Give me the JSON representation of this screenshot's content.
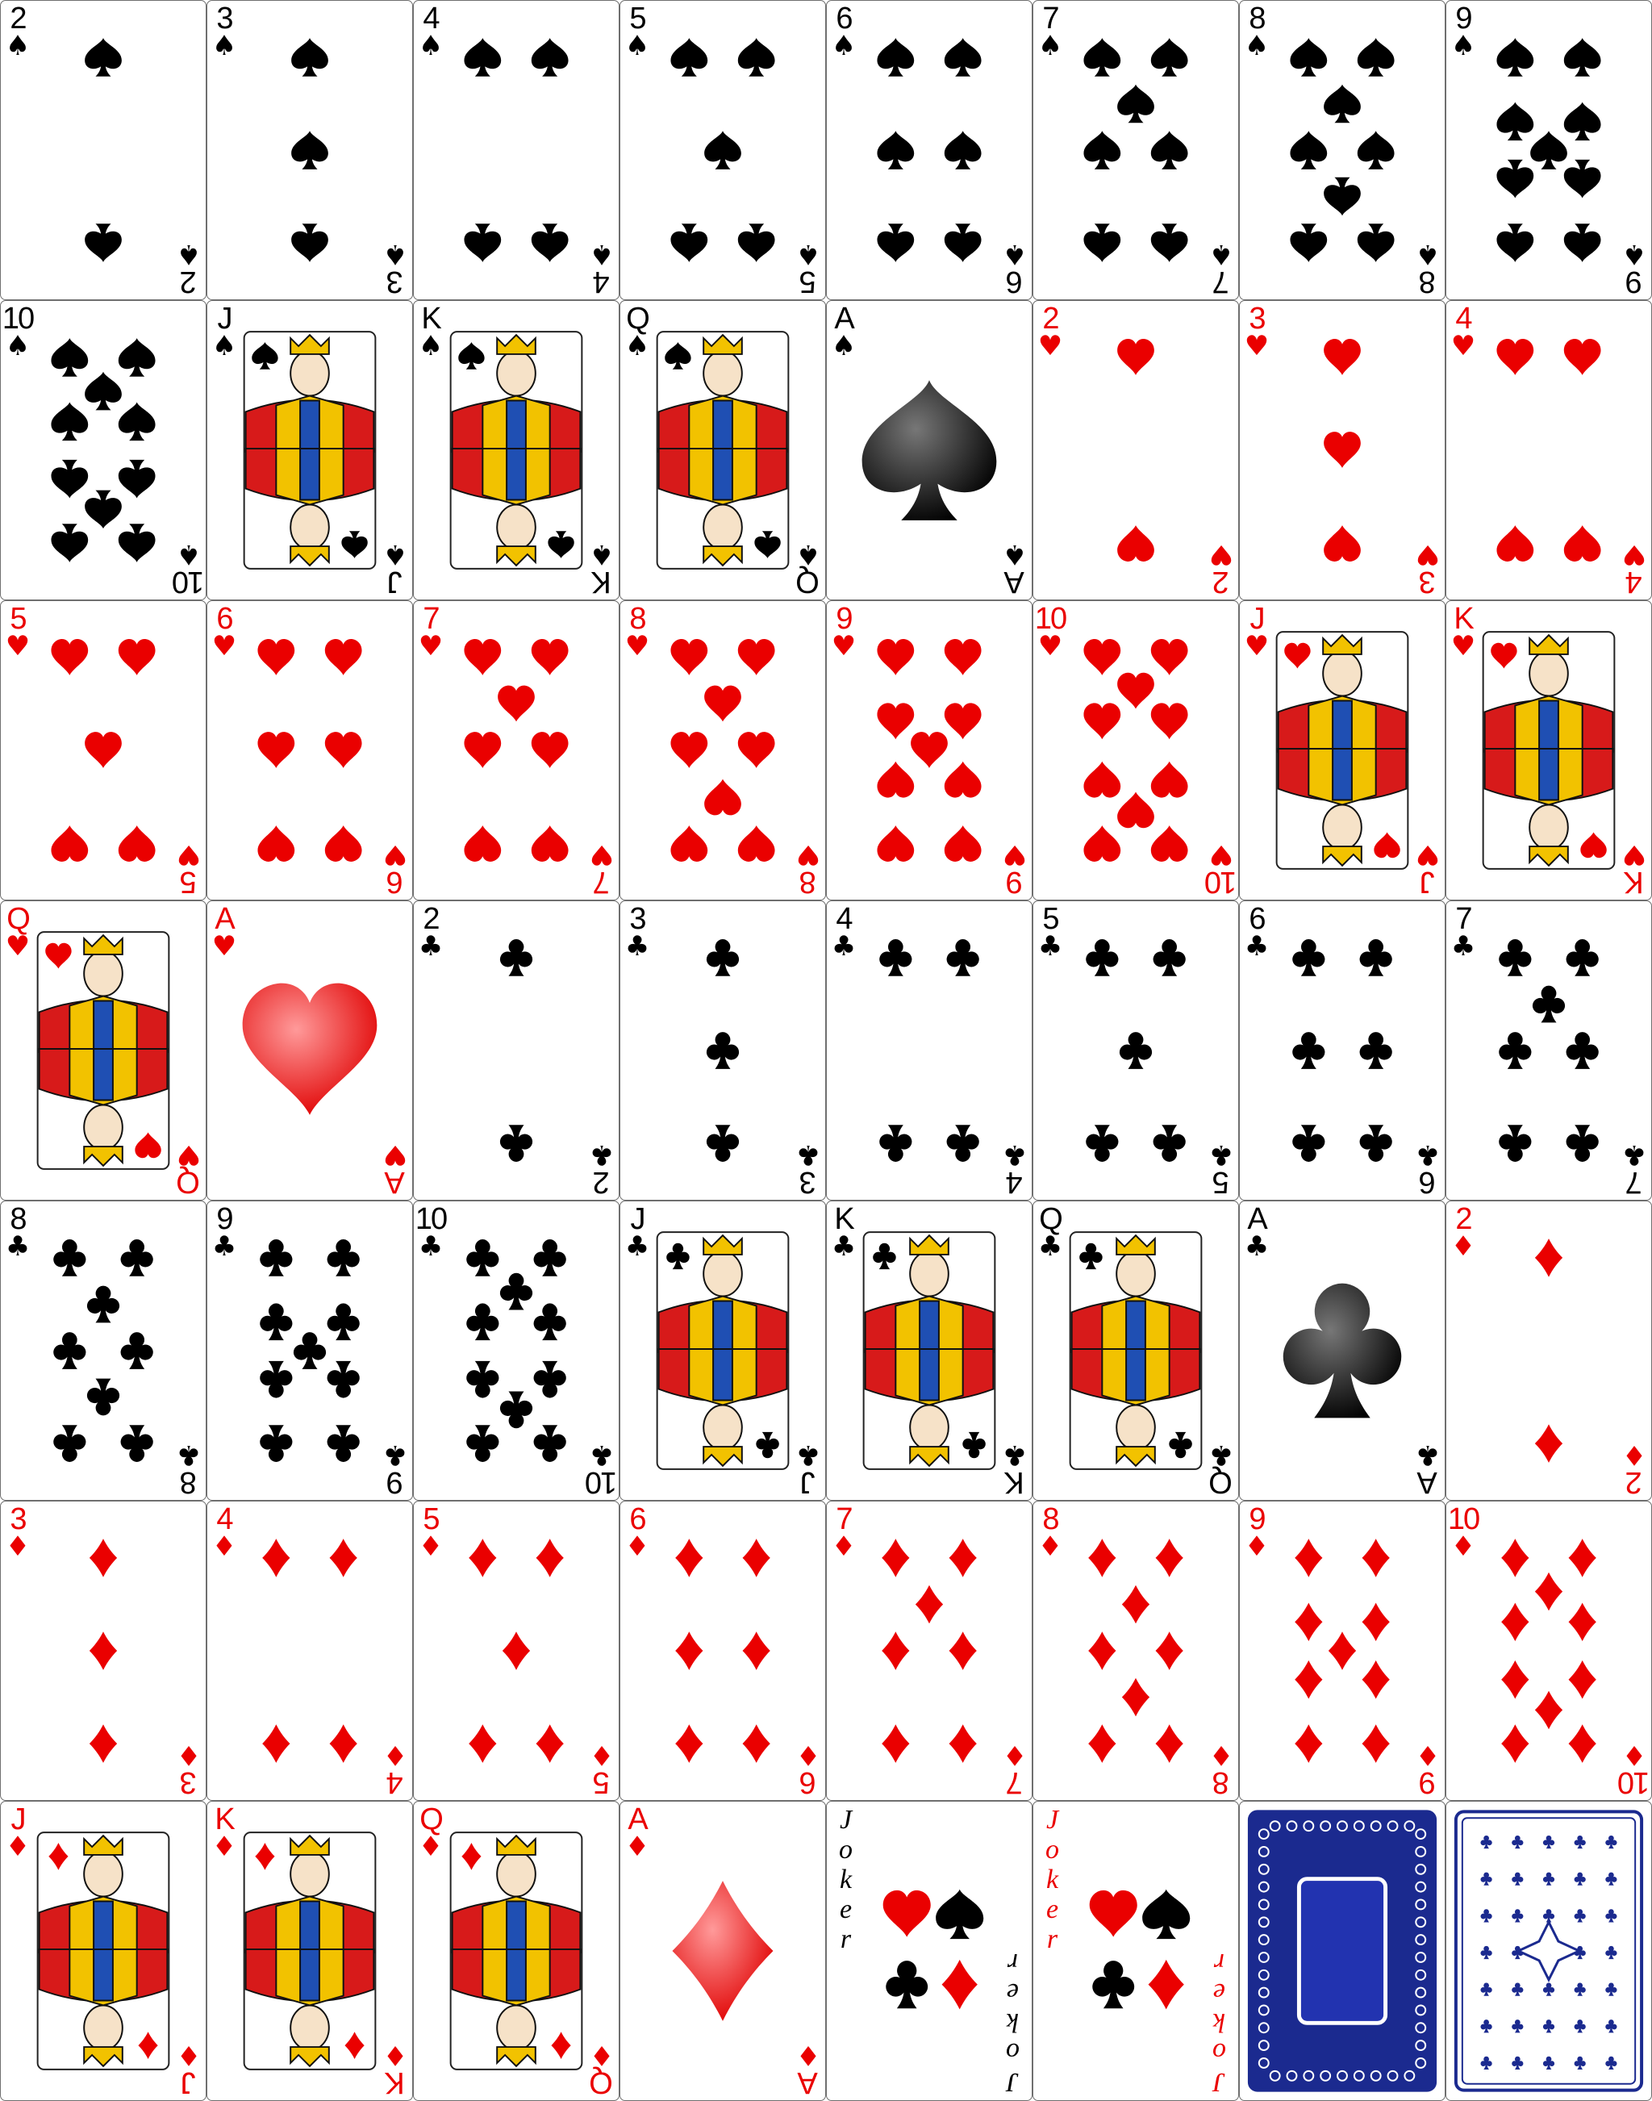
{
  "suit_glyphs": {
    "spades": "♠",
    "hearts": "♥",
    "clubs": "♣",
    "diamonds": "♦"
  },
  "colors": {
    "red_suit": "#ea0000",
    "black_suit": "#000000",
    "card_border": "#6f6f6f",
    "card_back_blue": "#1b2a8f",
    "card_face": "#ffffff"
  },
  "cards": [
    {
      "rank": "2",
      "suit": "spades"
    },
    {
      "rank": "3",
      "suit": "spades"
    },
    {
      "rank": "4",
      "suit": "spades"
    },
    {
      "rank": "5",
      "suit": "spades"
    },
    {
      "rank": "6",
      "suit": "spades"
    },
    {
      "rank": "7",
      "suit": "spades"
    },
    {
      "rank": "8",
      "suit": "spades"
    },
    {
      "rank": "9",
      "suit": "spades"
    },
    {
      "rank": "10",
      "suit": "spades"
    },
    {
      "rank": "J",
      "suit": "spades"
    },
    {
      "rank": "K",
      "suit": "spades"
    },
    {
      "rank": "Q",
      "suit": "spades"
    },
    {
      "rank": "A",
      "suit": "spades"
    },
    {
      "rank": "2",
      "suit": "hearts"
    },
    {
      "rank": "3",
      "suit": "hearts"
    },
    {
      "rank": "4",
      "suit": "hearts"
    },
    {
      "rank": "5",
      "suit": "hearts"
    },
    {
      "rank": "6",
      "suit": "hearts"
    },
    {
      "rank": "7",
      "suit": "hearts"
    },
    {
      "rank": "8",
      "suit": "hearts"
    },
    {
      "rank": "9",
      "suit": "hearts"
    },
    {
      "rank": "10",
      "suit": "hearts"
    },
    {
      "rank": "J",
      "suit": "hearts"
    },
    {
      "rank": "K",
      "suit": "hearts"
    },
    {
      "rank": "Q",
      "suit": "hearts"
    },
    {
      "rank": "A",
      "suit": "hearts"
    },
    {
      "rank": "2",
      "suit": "clubs"
    },
    {
      "rank": "3",
      "suit": "clubs"
    },
    {
      "rank": "4",
      "suit": "clubs"
    },
    {
      "rank": "5",
      "suit": "clubs"
    },
    {
      "rank": "6",
      "suit": "clubs"
    },
    {
      "rank": "7",
      "suit": "clubs"
    },
    {
      "rank": "8",
      "suit": "clubs"
    },
    {
      "rank": "9",
      "suit": "clubs"
    },
    {
      "rank": "10",
      "suit": "clubs"
    },
    {
      "rank": "J",
      "suit": "clubs"
    },
    {
      "rank": "K",
      "suit": "clubs"
    },
    {
      "rank": "Q",
      "suit": "clubs"
    },
    {
      "rank": "A",
      "suit": "clubs"
    },
    {
      "rank": "2",
      "suit": "diamonds"
    },
    {
      "rank": "3",
      "suit": "diamonds"
    },
    {
      "rank": "4",
      "suit": "diamonds"
    },
    {
      "rank": "5",
      "suit": "diamonds"
    },
    {
      "rank": "6",
      "suit": "diamonds"
    },
    {
      "rank": "7",
      "suit": "diamonds"
    },
    {
      "rank": "8",
      "suit": "diamonds"
    },
    {
      "rank": "9",
      "suit": "diamonds"
    },
    {
      "rank": "10",
      "suit": "diamonds"
    },
    {
      "rank": "J",
      "suit": "diamonds"
    },
    {
      "rank": "K",
      "suit": "diamonds"
    },
    {
      "rank": "Q",
      "suit": "diamonds"
    },
    {
      "rank": "A",
      "suit": "diamonds"
    },
    {
      "kind": "joker",
      "label": "Joker",
      "color": "black"
    },
    {
      "kind": "joker",
      "label": "Joker",
      "color": "red"
    },
    {
      "kind": "back",
      "style": "plain-frame"
    },
    {
      "kind": "back",
      "style": "ornate-pattern"
    }
  ]
}
